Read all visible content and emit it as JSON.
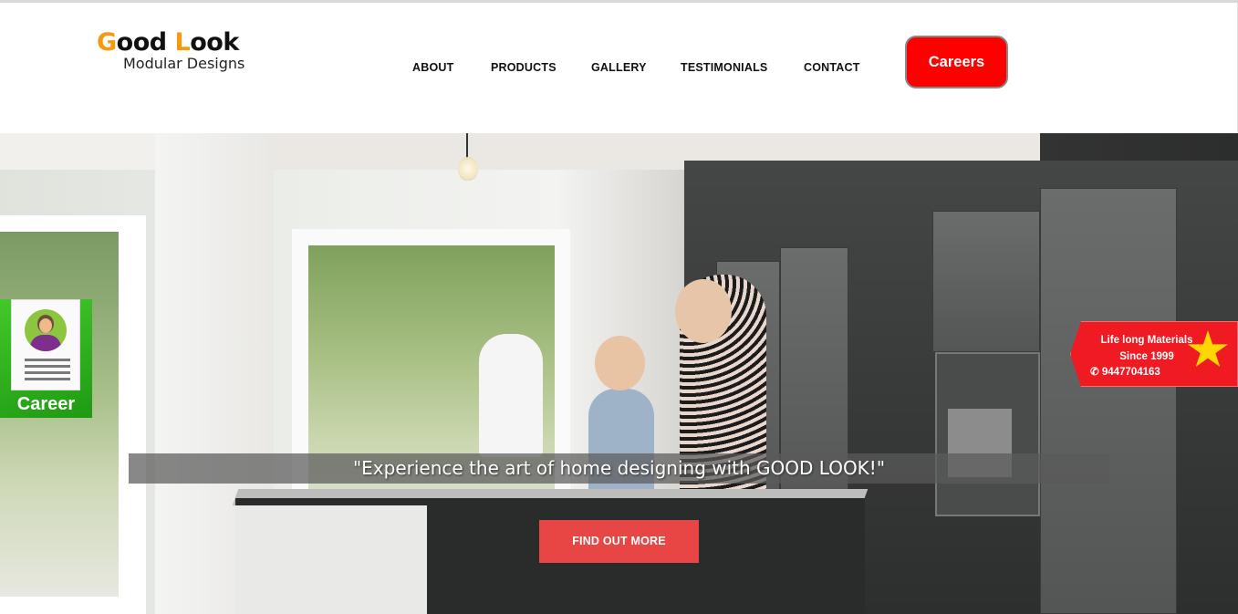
{
  "header": {
    "logo": {
      "title": "Good Look",
      "subtitle": "Modular Designs",
      "accent_color": "#f59a0c"
    },
    "nav": [
      {
        "label": "ABOUT"
      },
      {
        "label": "PRODUCTS"
      },
      {
        "label": "GALLERY"
      },
      {
        "label": "TESTIMONIALS"
      },
      {
        "label": "CONTACT"
      }
    ],
    "careers_button": {
      "label": "Careers",
      "color": "#ff0000"
    }
  },
  "hero": {
    "tagline": "\"Experience the art of home designing with GOOD LOOK!\"",
    "cta_label": "FIND OUT MORE",
    "cta_color": "#e84545",
    "career_badge": {
      "label": "Career",
      "icon": "resume-profile-icon",
      "color": "#2fb31e"
    },
    "promo_badge": {
      "line1": "Life long Materials",
      "line2": "Since 1999",
      "phone": "9447704163",
      "phone_icon": "phone-icon",
      "star_icon": "star-icon",
      "color": "#f01a22"
    }
  }
}
